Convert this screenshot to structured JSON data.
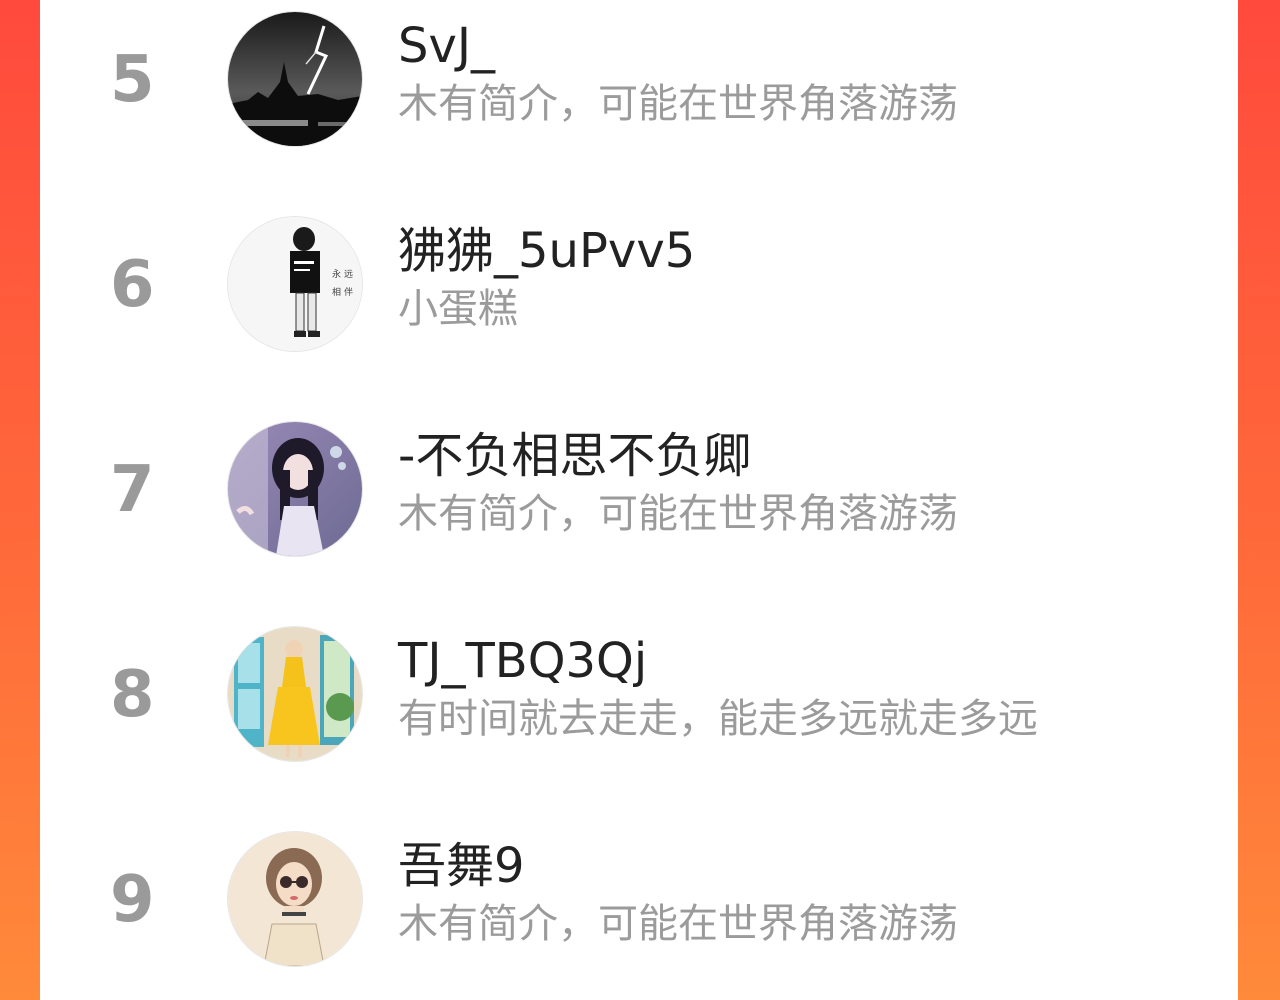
{
  "colors": {
    "background_start": "#ff4a3d",
    "background_end": "#ff8a3a",
    "rank_color": "#9a9a9a",
    "name_color": "#222222",
    "bio_color": "#9b9b9b"
  },
  "users": [
    {
      "rank": "5",
      "name": "SvJ_",
      "bio": "木有简介，可能在世界角落游荡",
      "avatar": "lightning-cityscape-avatar"
    },
    {
      "rank": "6",
      "name": "狒狒_5uPvv5",
      "bio": "小蛋糕",
      "avatar": "sketch-figure-avatar"
    },
    {
      "rank": "7",
      "name": "-不负相思不负卿",
      "bio": "木有简介，可能在世界角落游荡",
      "avatar": "anime-girl-avatar"
    },
    {
      "rank": "8",
      "name": "TJ_TBQ3Qj",
      "bio": "有时间就去走走，能走多远就走多远",
      "avatar": "yellow-dress-avatar"
    },
    {
      "rank": "9",
      "name": "吾舞9",
      "bio": "木有简介，可能在世界角落游荡",
      "avatar": "illustrated-girl-avatar"
    }
  ]
}
